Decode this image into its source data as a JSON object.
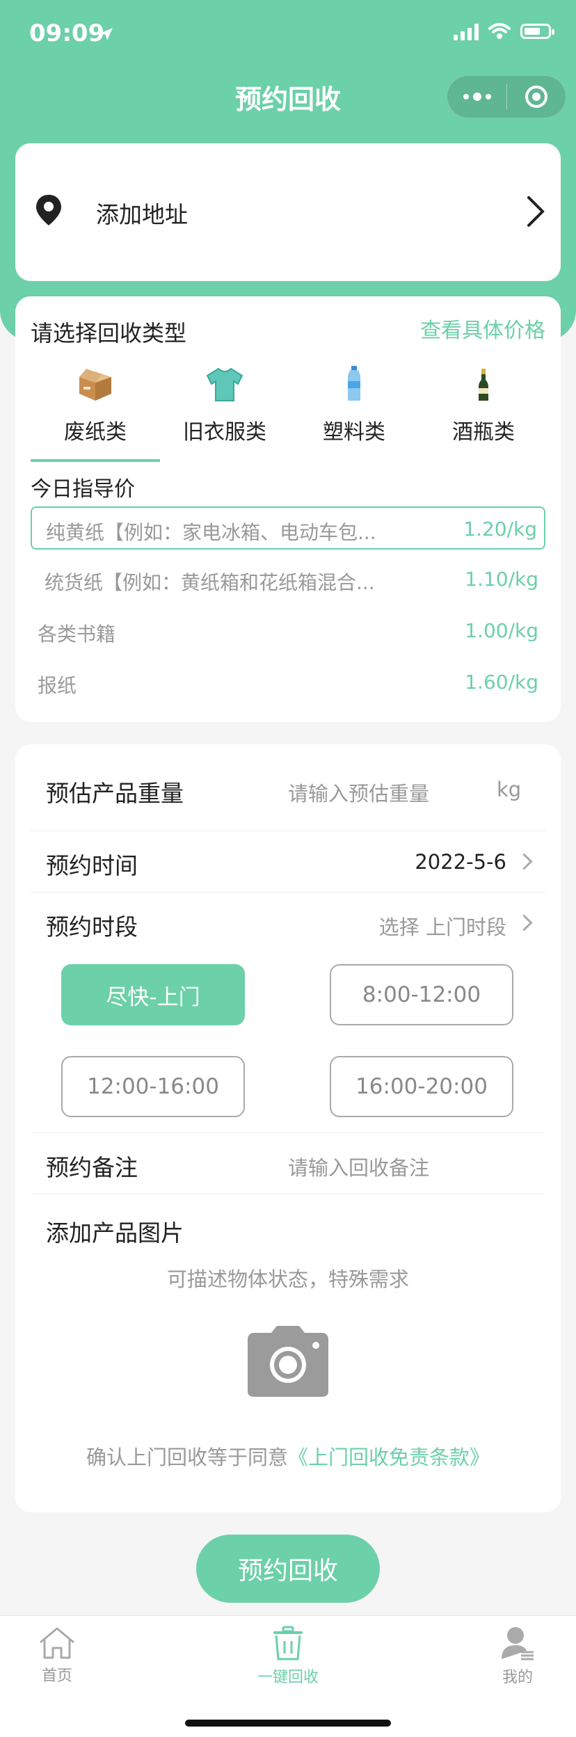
{
  "status_bar": {
    "time": "09:09"
  },
  "nav": {
    "title": "预约回收"
  },
  "address": {
    "label": "添加地址"
  },
  "recycle_types": {
    "title": "请选择回收类型",
    "price_link": "查看具体价格",
    "categories": [
      {
        "label": "废纸类",
        "icon": "cardboard-box-icon",
        "selected": true
      },
      {
        "label": "旧衣服类",
        "icon": "tshirt-icon",
        "selected": false
      },
      {
        "label": "塑料类",
        "icon": "plastic-bottle-icon",
        "selected": false
      },
      {
        "label": "酒瓶类",
        "icon": "wine-bottle-icon",
        "selected": false
      }
    ],
    "guide_title": "今日指导价",
    "prices": [
      {
        "name": "纯黄纸【例如：家电冰箱、电动车包...",
        "price": "1.20/kg"
      },
      {
        "name": "统货纸【例如：黄纸箱和花纸箱混合...",
        "price": "1.10/kg"
      },
      {
        "name": "各类书籍",
        "price": "1.00/kg"
      },
      {
        "name": "报纸",
        "price": "1.60/kg"
      }
    ]
  },
  "form": {
    "weight_label": "预估产品重量",
    "weight_placeholder": "请输入预估重量",
    "weight_unit": "kg",
    "time_label": "预约时间",
    "time_value": "2022-5-6",
    "period_label": "预约时段",
    "period_placeholder": "选择 上门时段",
    "slots": [
      "尽快-上门",
      "8:00-12:00",
      "12:00-16:00",
      "16:00-20:00"
    ],
    "selected_slot": "尽快-上门",
    "note_label": "预约备注",
    "note_placeholder": "请输入回收备注",
    "photo_label": "添加产品图片",
    "photo_hint": "可描述物体状态，特殊需求",
    "agree_text": "确认上门回收等于同意",
    "agree_link": "《上门回收免责条款》"
  },
  "submit_label": "预约回收",
  "tabbar": {
    "items": [
      {
        "label": "首页",
        "icon": "home-icon",
        "active": false
      },
      {
        "label": "一键回收",
        "icon": "trash-can-icon",
        "active": true
      },
      {
        "label": "我的",
        "icon": "user-icon",
        "active": false
      }
    ]
  },
  "colors": {
    "accent": "#6cd0a8",
    "background": "#f5f5f5",
    "muted": "#999999"
  }
}
